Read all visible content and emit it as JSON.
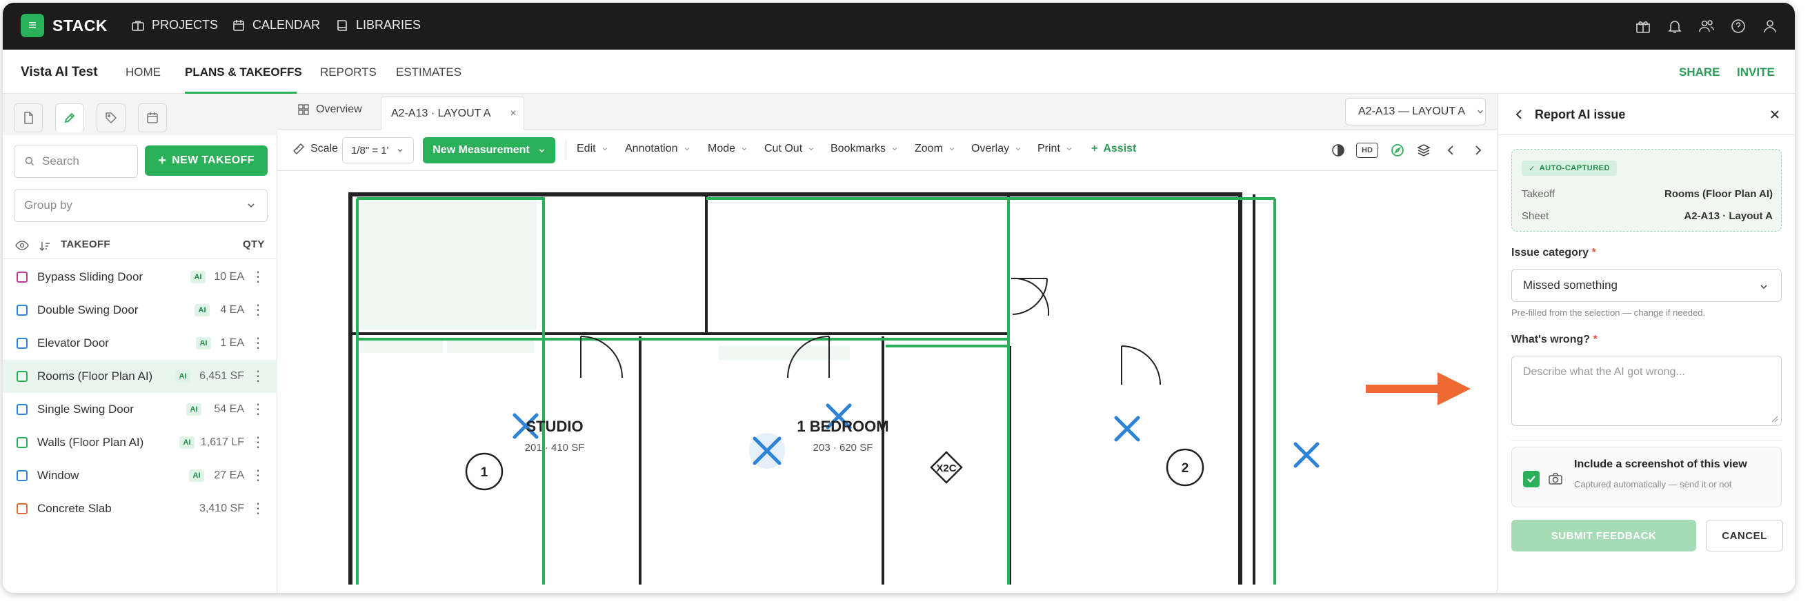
{
  "app": {
    "brand": "STACK",
    "accent": "#2bb05a",
    "arrow_color": "#ef6a32"
  },
  "topnav": {
    "items": [
      {
        "label": "PROJECTS",
        "icon": "briefcase-icon"
      },
      {
        "label": "CALENDAR",
        "icon": "calendar-icon"
      },
      {
        "label": "LIBRARIES",
        "icon": "book-icon"
      }
    ],
    "right_icons": [
      "gift-icon",
      "bell-icon",
      "users-icon",
      "help-icon",
      "user-icon"
    ]
  },
  "subnav": {
    "project": "Vista AI Test",
    "tabs": [
      "HOME",
      "PLANS & TAKEOFFS",
      "REPORTS",
      "ESTIMATES"
    ],
    "active_tab": "PLANS & TAKEOFFS",
    "share": "SHARE",
    "invite": "INVITE"
  },
  "left": {
    "search_placeholder": "Search",
    "new_takeoff": "NEW TAKEOFF",
    "group_by": "Group by",
    "col_takeoff": "TAKEOFF",
    "col_qty": "QTY",
    "ai_badge": "AI",
    "rows": [
      {
        "name": "Bypass Sliding Door",
        "ai": true,
        "qty": "10 EA",
        "color": "#c0398f"
      },
      {
        "name": "Double Swing Door",
        "ai": true,
        "qty": "4 EA",
        "color": "#2d83d6"
      },
      {
        "name": "Elevator Door",
        "ai": true,
        "qty": "1 EA",
        "color": "#2d83d6"
      },
      {
        "name": "Rooms (Floor Plan AI)",
        "ai": true,
        "qty": "6,451 SF",
        "color": "#2bb05a",
        "selected": true
      },
      {
        "name": "Single Swing Door",
        "ai": true,
        "qty": "54 EA",
        "color": "#2d83d6"
      },
      {
        "name": "Walls (Floor Plan AI)",
        "ai": true,
        "qty": "1,617 LF",
        "color": "#2bb05a"
      },
      {
        "name": "Window",
        "ai": true,
        "qty": "27 EA",
        "color": "#2d83d6"
      },
      {
        "name": "Concrete Slab",
        "ai": false,
        "qty": "3,410 SF",
        "color": "#e46a37"
      }
    ]
  },
  "tabs": {
    "overview": "Overview",
    "doc": "A2-A13 · LAYOUT A",
    "sheet_select": "A2-A13 — LAYOUT A"
  },
  "toolbar": {
    "scale_label": "Scale",
    "scale_value": "1/8\" = 1'",
    "new_measurement": "New Measurement",
    "menus": [
      "Edit",
      "Annotation",
      "Mode",
      "Cut Out",
      "Bookmarks",
      "Zoom",
      "Overlay",
      "Print"
    ],
    "assist": "Assist",
    "hd": "HD"
  },
  "plan": {
    "rooms": [
      {
        "name": "STUDIO",
        "detail": "201 · 410 SF"
      },
      {
        "name": "1 BEDROOM",
        "detail": "203 · 620 SF"
      }
    ],
    "tags": [
      "1",
      "2"
    ],
    "door_tag": "X2C"
  },
  "report": {
    "title": "Report AI issue",
    "auto_captured": "AUTO-CAPTURED",
    "takeoff_key": "Takeoff",
    "takeoff_val": "Rooms (Floor Plan AI)",
    "sheet_key": "Sheet",
    "sheet_val": "A2-A13 · Layout A",
    "category_label": "Issue category",
    "category_value": "Missed something",
    "helper": "Pre-filled from the selection — change if needed.",
    "wrong_label": "What's wrong?",
    "wrong_placeholder": "Describe what the AI got wrong...",
    "required": "*",
    "screenshot_title": "Include a screenshot of this view",
    "screenshot_sub": "Captured automatically — send it or not",
    "screenshot_checked": true,
    "submit": "SUBMIT FEEDBACK",
    "cancel": "CANCEL"
  }
}
